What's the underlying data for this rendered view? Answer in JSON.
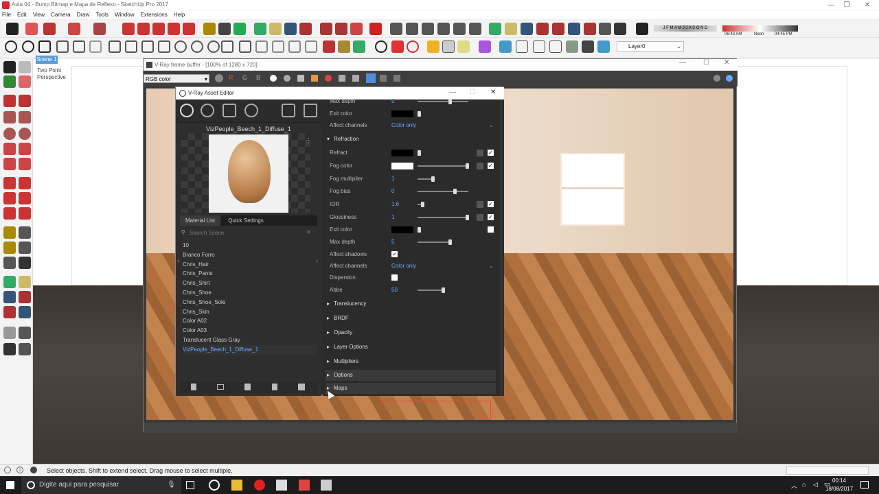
{
  "window": {
    "title": "Aula 04 - Bump Bitmap e Mapa de Reflexo - SketchUp Pro 2017"
  },
  "menu": [
    "File",
    "Edit",
    "View",
    "Camera",
    "Draw",
    "Tools",
    "Window",
    "Extensions",
    "Help"
  ],
  "toolbar": {
    "months": "J F M A M J J A S O N D",
    "time1": "06:43 AM",
    "noon": "Noon",
    "time2": "04:45 PM",
    "layer": "Layer0"
  },
  "scene": {
    "tab": "Scene 1",
    "perspective": "Two Point\nPerspective"
  },
  "vfb": {
    "title": "V-Ray frame buffer - [100% of 1280 x 720]",
    "channel": "RGB color"
  },
  "asset_editor": {
    "title": "V-Ray Asset Editor",
    "material_name": "VizPeople_Beech_1_Diffuse_1",
    "tabs": [
      "Material List",
      "Quick Settings"
    ],
    "search_placeholder": "Search Scene",
    "materials": [
      "10",
      "Branco Forro",
      "Chris_Hair",
      "Chris_Pants",
      "Chris_Shirt",
      "Chris_Shoe",
      "Chris_Shoe_Sole",
      "Chris_Skin",
      "Color A02",
      "Color A03",
      "Translucent Glass Gray",
      "VizPeople_Beech_1_Diffuse_1"
    ],
    "params_top": {
      "max_depth": "Max depth",
      "max_depth_val": "5",
      "exit_color": "Exit color",
      "affect_channels": "Affect channels",
      "affect_val": "Color only"
    },
    "refraction": {
      "header": "Refraction",
      "refract": "Refract",
      "fog_color": "Fog color",
      "fog_multiplier": "Fog multiplier",
      "fog_multiplier_val": "1",
      "fog_bias": "Fog bias",
      "fog_bias_val": "0",
      "ior": "IOR",
      "ior_val": "1,6",
      "glossiness": "Glossiness",
      "glossiness_val": "1",
      "exit_color": "Exit color",
      "max_depth": "Max depth",
      "max_depth_val": "5",
      "affect_shadows": "Affect shadows",
      "affect_channels": "Affect channels",
      "affect_val": "Color only",
      "dispersion": "Dispersion",
      "abbe": "Abbe",
      "abbe_val": "50"
    },
    "sections": [
      "Translucency",
      "BRDF",
      "Opacity",
      "Layer Options",
      "Multipliers",
      "Options",
      "Maps"
    ]
  },
  "status": {
    "text": "Select objects. Shift to extend select. Drag mouse to select multiple."
  },
  "taskbar": {
    "search": "Digite aqui para pesquisar",
    "time": "00:14",
    "date": "18/08/2017"
  }
}
